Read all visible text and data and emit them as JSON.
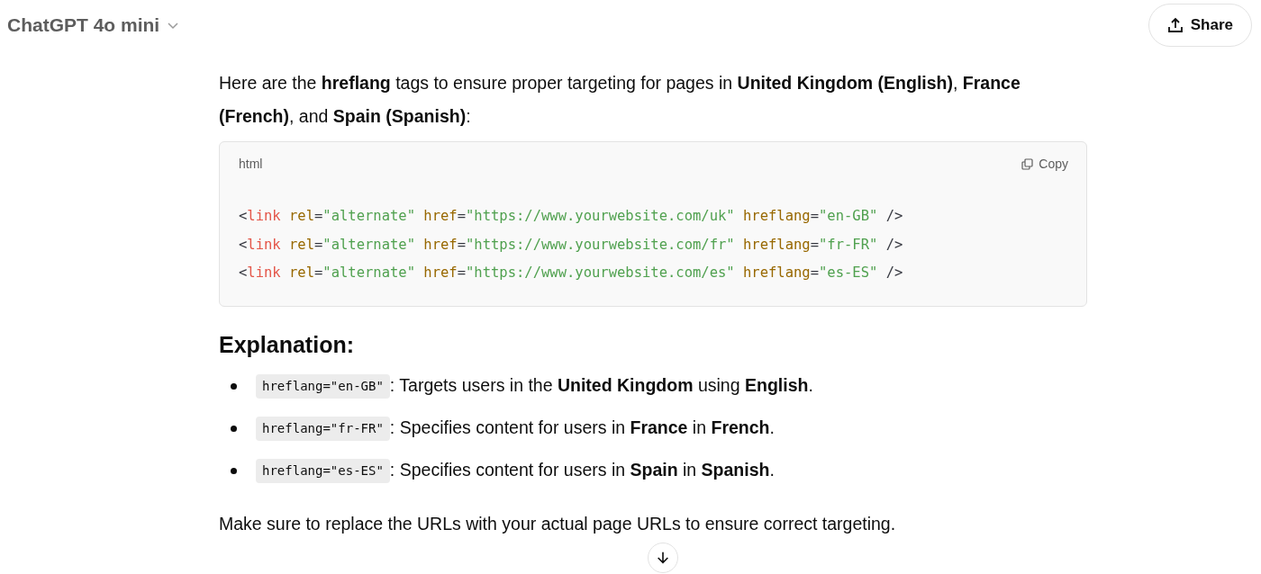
{
  "header": {
    "model_title": "ChatGPT 4o mini",
    "share_button": "Share"
  },
  "intro": "Here are the **hreflang** tags to ensure proper targeting for pages in **United Kingdom (English)**, **France (French)**, and **Spain (Spanish)**:",
  "code_block": {
    "language": "html",
    "copy_button": "Copy",
    "lines": [
      [
        {
          "kind": "punct",
          "text": "<"
        },
        {
          "kind": "tag",
          "text": "link"
        },
        {
          "kind": "attr",
          "text": " rel"
        },
        {
          "kind": "punct",
          "text": "="
        },
        {
          "kind": "string",
          "text": "\"alternate\""
        },
        {
          "kind": "attr",
          "text": " href"
        },
        {
          "kind": "punct",
          "text": "="
        },
        {
          "kind": "string",
          "text": "\"https://www.yourwebsite.com/uk\""
        },
        {
          "kind": "attr",
          "text": " hreflang"
        },
        {
          "kind": "punct",
          "text": "="
        },
        {
          "kind": "string",
          "text": "\"en-GB\""
        },
        {
          "kind": "punct",
          "text": " />"
        }
      ],
      [
        {
          "kind": "punct",
          "text": "<"
        },
        {
          "kind": "tag",
          "text": "link"
        },
        {
          "kind": "attr",
          "text": " rel"
        },
        {
          "kind": "punct",
          "text": "="
        },
        {
          "kind": "string",
          "text": "\"alternate\""
        },
        {
          "kind": "attr",
          "text": " href"
        },
        {
          "kind": "punct",
          "text": "="
        },
        {
          "kind": "string",
          "text": "\"https://www.yourwebsite.com/fr\""
        },
        {
          "kind": "attr",
          "text": " hreflang"
        },
        {
          "kind": "punct",
          "text": "="
        },
        {
          "kind": "string",
          "text": "\"fr-FR\""
        },
        {
          "kind": "punct",
          "text": " />"
        }
      ],
      [
        {
          "kind": "punct",
          "text": "<"
        },
        {
          "kind": "tag",
          "text": "link"
        },
        {
          "kind": "attr",
          "text": " rel"
        },
        {
          "kind": "punct",
          "text": "="
        },
        {
          "kind": "string",
          "text": "\"alternate\""
        },
        {
          "kind": "attr",
          "text": " href"
        },
        {
          "kind": "punct",
          "text": "="
        },
        {
          "kind": "string",
          "text": "\"https://www.yourwebsite.com/es\""
        },
        {
          "kind": "attr",
          "text": " hreflang"
        },
        {
          "kind": "punct",
          "text": "="
        },
        {
          "kind": "string",
          "text": "\"es-ES\""
        },
        {
          "kind": "punct",
          "text": " />"
        }
      ]
    ]
  },
  "explanation_heading": "Explanation:",
  "bullets": [
    {
      "code": "hreflang=\"en-GB\"",
      "text": ": Targets users in the **United Kingdom** using **English**."
    },
    {
      "code": "hreflang=\"fr-FR\"",
      "text": ": Specifies content for users in **France** in **French**."
    },
    {
      "code": "hreflang=\"es-ES\"",
      "text": ": Specifies content for users in **Spain** in **Spanish**."
    }
  ],
  "closing": "Make sure to replace the URLs with your actual page URLs to ensure correct targeting."
}
